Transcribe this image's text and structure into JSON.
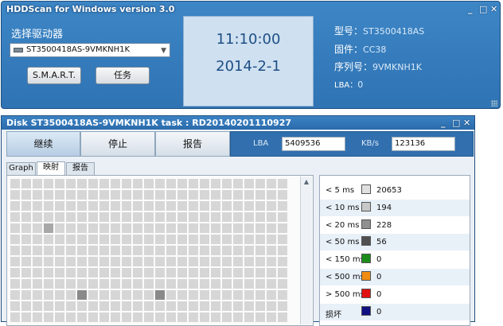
{
  "main_window": {
    "title": "HDDScan for Windows version 3.0",
    "controls": {
      "minimize": "_",
      "maximize": "□",
      "close": "✕"
    },
    "drive_label": "选择驱动器",
    "drive_selected": "ST3500418AS-9VMKNH1K",
    "smart_button": "S.M.A.R.T.",
    "tasks_button": "任务",
    "time": "11:10:00",
    "date": "2014-2-1",
    "model_label": "型号：",
    "model_value": "ST3500418AS",
    "firmware_label": "固件：",
    "firmware_value": "CC38",
    "serial_label": "序列号：",
    "serial_value": "9VMKNH1K",
    "lba_label": "LBA：",
    "lba_value": "0"
  },
  "task_window": {
    "title": "Disk ST3500418AS-9VMKNH1K   task : RD20140201110927",
    "controls": {
      "minimize": "_",
      "maximize": "□",
      "close": "✕"
    },
    "continue_button": "继续",
    "stop_button": "停止",
    "report_button": "报告",
    "lba_label": "LBA",
    "lba_value": "5409536",
    "kbs_label": "KB/s",
    "kbs_value": "123136",
    "tabs": [
      "Graph",
      "映射",
      "报告"
    ],
    "selected_tab": "映射",
    "legend": [
      {
        "label": "< 5 ms",
        "color": "#e0e0e0",
        "count": "20653"
      },
      {
        "label": "< 10 ms",
        "color": "#c8c8c8",
        "count": "194"
      },
      {
        "label": "< 20 ms",
        "color": "#909090",
        "count": "228"
      },
      {
        "label": "< 50 ms",
        "color": "#505050",
        "count": "56"
      },
      {
        "label": "< 150 ms",
        "color": "#1a8c1a",
        "count": "0"
      },
      {
        "label": "< 500 ms",
        "color": "#f08c10",
        "count": "0"
      },
      {
        "label": "> 500 ms",
        "color": "#e01010",
        "count": "0"
      },
      {
        "label": "损坏",
        "color": "#101080",
        "count": "0"
      }
    ]
  }
}
